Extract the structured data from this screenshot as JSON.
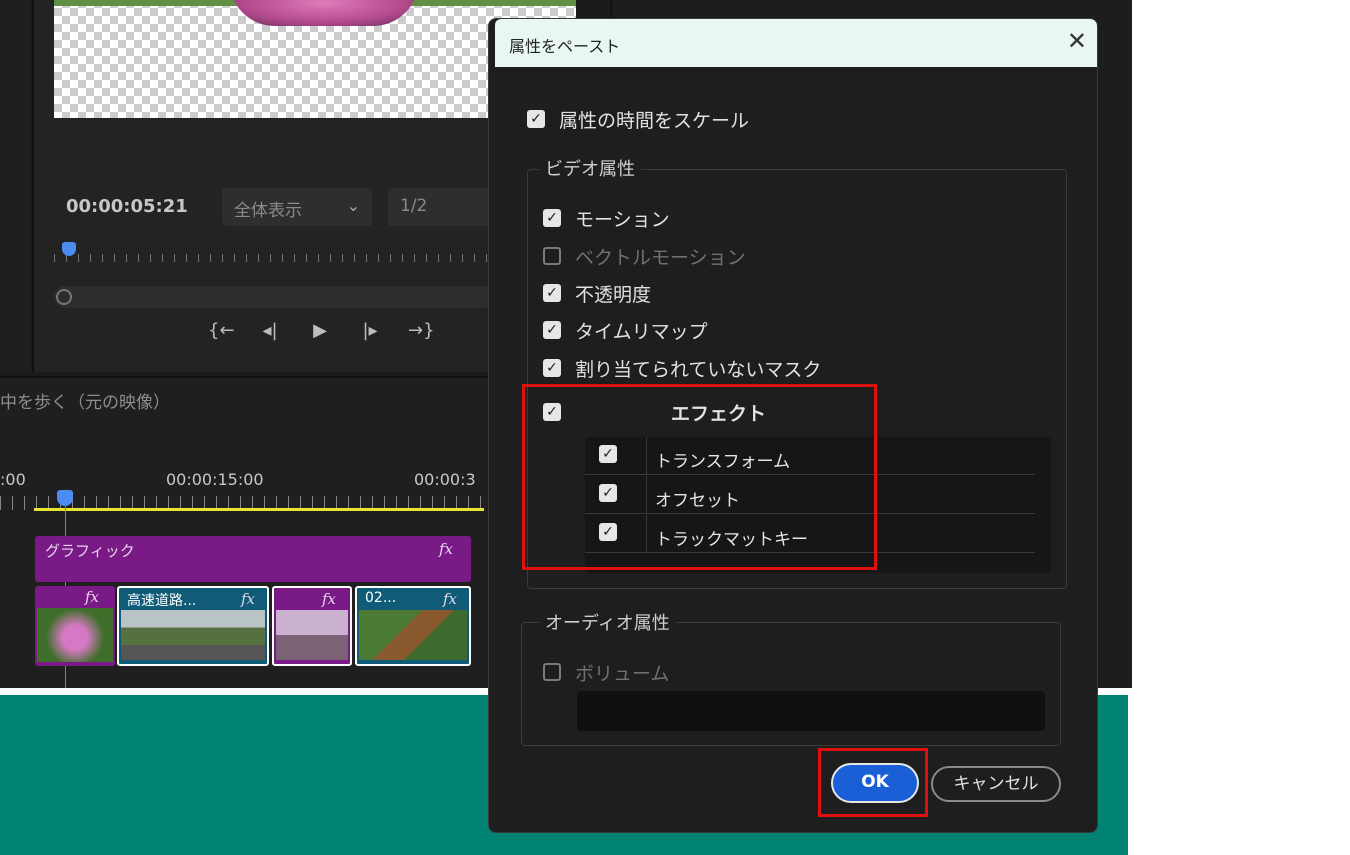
{
  "monitor": {
    "timecode": "00:00:05:21",
    "zoom_dropdown": "全体表示",
    "resolution_dropdown": "1/2"
  },
  "timeline": {
    "sequence_title": "中を歩く（元の映像）",
    "ruler_labels": [
      ":00",
      "00:00:15:00",
      "00:00:3"
    ],
    "graphic_clip": "グラフィック",
    "fx_badge": "fx",
    "video_clips": [
      "高速道路...",
      "02..."
    ]
  },
  "dialog": {
    "title": "属性をペースト",
    "close_glyph": "✕",
    "scale_time_label": "属性の時間をスケール",
    "video_group": "ビデオ属性",
    "video_items": [
      {
        "label": "モーション",
        "checked": true,
        "enabled": true
      },
      {
        "label": "ベクトルモーション",
        "checked": false,
        "enabled": false
      },
      {
        "label": "不透明度",
        "checked": true,
        "enabled": true
      },
      {
        "label": "タイムリマップ",
        "checked": true,
        "enabled": true
      },
      {
        "label": "割り当てられていないマスク",
        "checked": true,
        "enabled": true
      }
    ],
    "effects_label": "エフェクト",
    "effects": [
      "トランスフォーム",
      "オフセット",
      "トラックマットキー"
    ],
    "audio_group": "オーディオ属性",
    "volume_label": "ボリューム",
    "ok_label": "OK",
    "cancel_label": "キャンセル"
  },
  "colors": {
    "highlight": "#e01010",
    "ok_button": "#1a5fd6",
    "graphic_clip": "#7a1a86",
    "video_clip": "#0f5b78",
    "background_teal": "#008373"
  }
}
